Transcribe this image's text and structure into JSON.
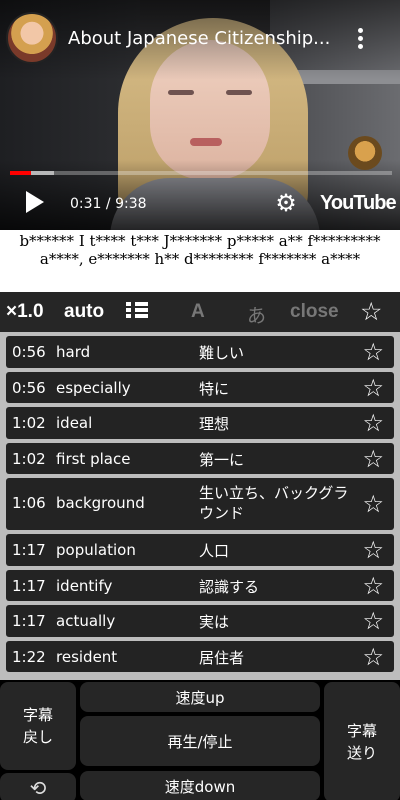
{
  "player": {
    "title": "About Japanese Citizenship...",
    "current_time": "0:31",
    "duration": "9:38",
    "time_separator": " / ",
    "progress_fraction": 0.054,
    "buffer_fraction": 0.115,
    "brand": "YouTube",
    "icons": {
      "menu": "more-vertical-icon",
      "play": "play-icon",
      "settings": "gear-icon"
    }
  },
  "subtitle": {
    "masked_text": "b****** I t**** t*** J******* p***** a** f********* a****, e******* h** d******** f******* a****"
  },
  "controls": {
    "speed": "×1.0",
    "auto": "auto",
    "list_icon": "list-icon",
    "font_toggle": "A",
    "kana_toggle": "あ",
    "close": "close",
    "star": "☆"
  },
  "words": [
    {
      "time": "0:56",
      "en": "hard",
      "jp": "難しい"
    },
    {
      "time": "0:56",
      "en": "especially",
      "jp": "特に"
    },
    {
      "time": "1:02",
      "en": "ideal",
      "jp": "理想"
    },
    {
      "time": "1:02",
      "en": "first place",
      "jp": "第一に"
    },
    {
      "time": "1:06",
      "en": "background",
      "jp": "生い立ち、バックグラウンド"
    },
    {
      "time": "1:17",
      "en": "population",
      "jp": "人口"
    },
    {
      "time": "1:17",
      "en": "identify",
      "jp": "認識する"
    },
    {
      "time": "1:17",
      "en": "actually",
      "jp": "実は"
    },
    {
      "time": "1:22",
      "en": "resident",
      "jp": "居住者"
    }
  ],
  "bottom": {
    "back_line1": "字幕",
    "back_line2": "戻し",
    "speed_up": "速度up",
    "play_pause": "再生/停止",
    "speed_down": "速度down",
    "forward_line1": "字幕",
    "forward_line2": "送り",
    "repeat_icon": "repeat-one-icon"
  }
}
